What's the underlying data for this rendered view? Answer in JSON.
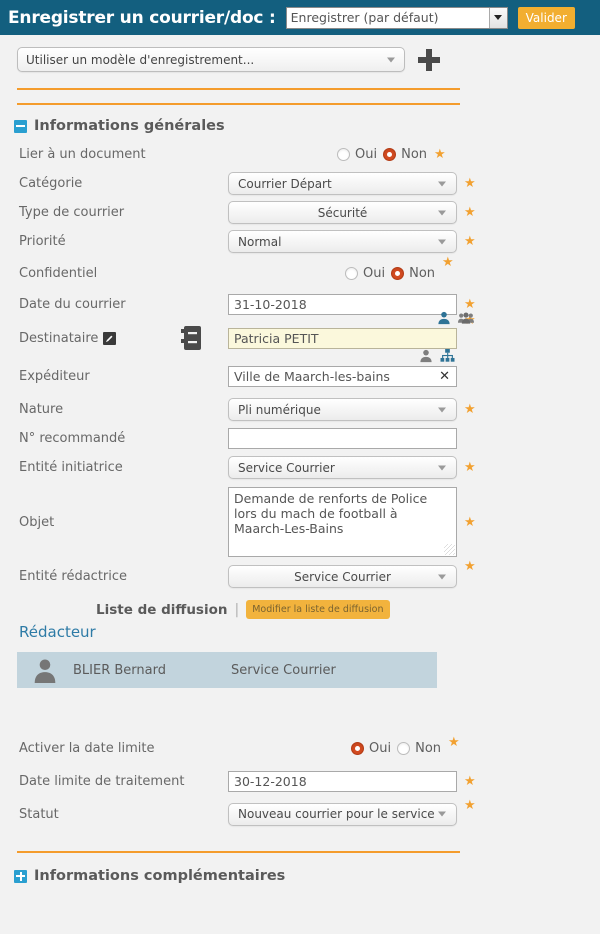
{
  "header": {
    "title": "Enregistrer un courrier/doc :",
    "action_select_value": "Enregistrer (par défaut)",
    "validate_label": "Valider"
  },
  "template_bar": {
    "model_select_value": "Utiliser un modèle d'enregistrement...",
    "add_icon": "plus-icon"
  },
  "sections": {
    "general": {
      "title": "Informations générales",
      "toggle_state": "expanded"
    },
    "complementary": {
      "title": "Informations complémentaires",
      "toggle_state": "collapsed"
    }
  },
  "colors": {
    "header_bg": "#135f7f",
    "accent_orange": "#f49c2d",
    "button_yellow": "#f2ae30",
    "radio_selected": "#d24a20",
    "toggle_blue": "#2a9fd0",
    "card_bg": "#c2d4dd",
    "link_blue": "#2e7ba6",
    "highlight_field": "#fbf8dc"
  },
  "fields": {
    "link_document": {
      "label": "Lier à un document",
      "options": [
        "Oui",
        "Non"
      ],
      "selected": "Non",
      "required": true
    },
    "category": {
      "label": "Catégorie",
      "value": "Courrier Départ",
      "required": true
    },
    "mail_type": {
      "label": "Type de courrier",
      "value": "Sécurité",
      "required": true
    },
    "priority": {
      "label": "Priorité",
      "value": "Normal",
      "required": true
    },
    "confidential": {
      "label": "Confidentiel",
      "options": [
        "Oui",
        "Non"
      ],
      "selected": "Non",
      "required": true
    },
    "mail_date": {
      "label": "Date du courrier",
      "value": "31-10-2018",
      "required": true
    },
    "recipient": {
      "label": "Destinataire",
      "value": "Patricia PETIT",
      "required": true,
      "edit_icon": "pencil-icon",
      "book_icon": "address-book-icon",
      "mode_icons": [
        "user-icon",
        "group-icon"
      ],
      "mode_selected": "user-icon"
    },
    "sender": {
      "label": "Expéditeur",
      "value": "Ville de Maarch-les-bains",
      "required": false,
      "mode_icons": [
        "user-icon",
        "organization-icon"
      ],
      "mode_selected": "organization-icon",
      "clear_icon": "close-icon"
    },
    "nature": {
      "label": "Nature",
      "value": "Pli numérique",
      "required": true
    },
    "registered_number": {
      "label": "N° recommandé",
      "value": "",
      "required": false
    },
    "initiating_entity": {
      "label": "Entité initiatrice",
      "value": "Service Courrier",
      "required": true
    },
    "subject": {
      "label": "Objet",
      "value": "Demande de renforts de Police lors du mach de football à Maarch-Les-Bains",
      "required": true
    },
    "writing_entity": {
      "label": "Entité rédactrice",
      "value": "Service Courrier",
      "required": true
    },
    "enable_deadline": {
      "label": "Activer la date limite",
      "options": [
        "Oui",
        "Non"
      ],
      "selected": "Oui",
      "required": true
    },
    "deadline_date": {
      "label": "Date limite de traitement",
      "value": "30-12-2018",
      "required": true
    },
    "status": {
      "label": "Statut",
      "value": "Nouveau courrier pour le service",
      "required": true
    }
  },
  "diffusion": {
    "label": "Liste de diffusion",
    "separator": "|",
    "modify_button": "Modifier la liste de diffusion",
    "redacteur_title": "Rédacteur",
    "redacteur": {
      "name": "BLIER Bernard",
      "entity": "Service Courrier",
      "avatar_icon": "user-avatar-icon"
    }
  },
  "required_marker": "★"
}
